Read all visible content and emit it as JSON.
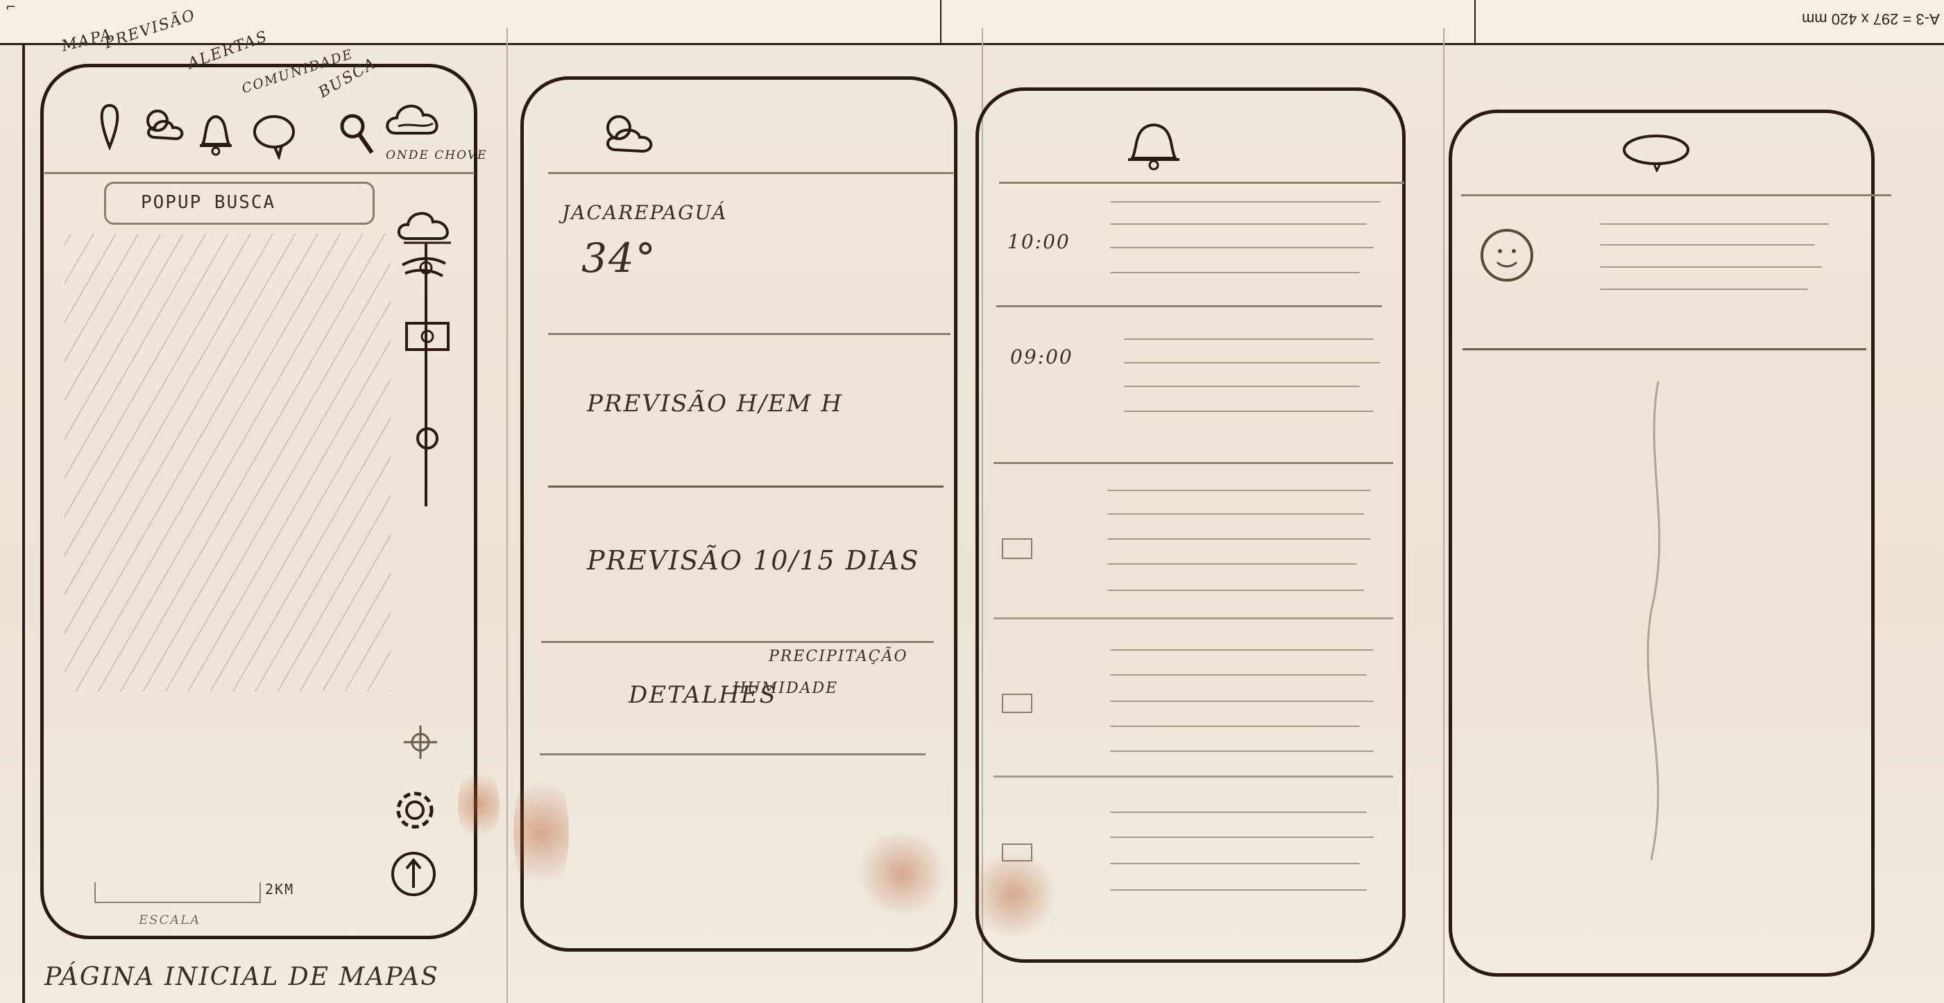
{
  "sheet": {
    "size_label": "A-3 = 297 x 420 mm"
  },
  "screen1": {
    "icon_labels": {
      "map": "MAPA",
      "forecast": "PREVISÃO",
      "alerts": "ALERTAS",
      "community": "COMUNIDADE",
      "search": "BUSCA",
      "where_rain": "ONDE CHOVE"
    },
    "search_bar": "POPUP BUSCA",
    "scale_label": "ESCALA",
    "scale_value": "2KM",
    "caption": "PÁGINA INICIAL DE MAPAS"
  },
  "screen2": {
    "city": "JACAREPAGUÁ",
    "temperature": "34°",
    "hourly": "PREVISÃO H/EM H",
    "daily": "PREVISÃO 10/15 DIAS",
    "details": "DETALHES",
    "detail_precip": "PRECIPITAÇÃO",
    "detail_humidity": "HUMIDADE"
  },
  "screen3": {
    "times": [
      "10:00",
      "09:00"
    ]
  },
  "screen4": {}
}
